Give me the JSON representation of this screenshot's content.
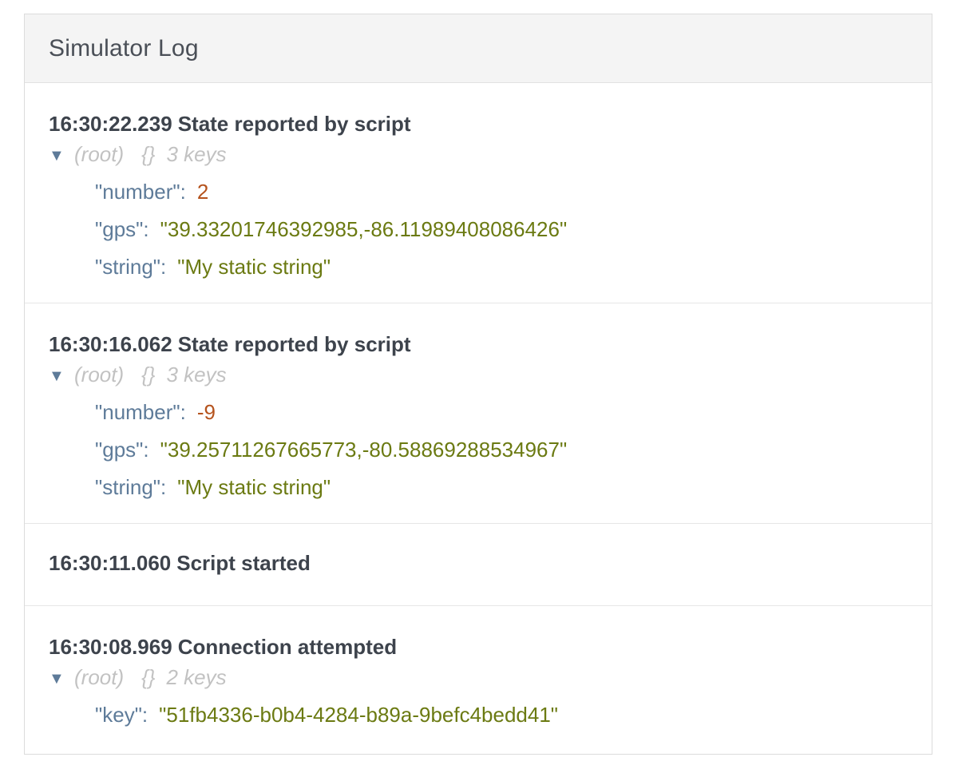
{
  "panel": {
    "title": "Simulator Log"
  },
  "entries": [
    {
      "time": "16:30:22.239",
      "message": "State reported by script",
      "tree": {
        "root_label": "(root)",
        "braces": "{}",
        "count_label": "3 keys",
        "items": [
          {
            "key": "\"number\"",
            "value": "2",
            "type": "number"
          },
          {
            "key": "\"gps\"",
            "value": "\"39.33201746392985,-86.11989408086426\"",
            "type": "string"
          },
          {
            "key": "\"string\"",
            "value": "\"My static string\"",
            "type": "string"
          }
        ]
      }
    },
    {
      "time": "16:30:16.062",
      "message": "State reported by script",
      "tree": {
        "root_label": "(root)",
        "braces": "{}",
        "count_label": "3 keys",
        "items": [
          {
            "key": "\"number\"",
            "value": "-9",
            "type": "number"
          },
          {
            "key": "\"gps\"",
            "value": "\"39.25711267665773,-80.58869288534967\"",
            "type": "string"
          },
          {
            "key": "\"string\"",
            "value": "\"My static string\"",
            "type": "string"
          }
        ]
      }
    },
    {
      "time": "16:30:11.060",
      "message": "Script started"
    },
    {
      "time": "16:30:08.969",
      "message": "Connection attempted",
      "tree": {
        "root_label": "(root)",
        "braces": "{}",
        "count_label": "2 keys",
        "items": [
          {
            "key": "\"key\"",
            "value": "\"51fb4336-b0b4-4284-b89a-9befc4bedd41\"",
            "type": "string"
          }
        ]
      }
    }
  ],
  "colors": {
    "key": "#5e7b99",
    "number": "#b5531d",
    "string": "#6b7a12",
    "muted": "#c2c2c2",
    "header_bg": "#f4f4f4"
  },
  "icons": {
    "expand": "caret-down-icon"
  }
}
